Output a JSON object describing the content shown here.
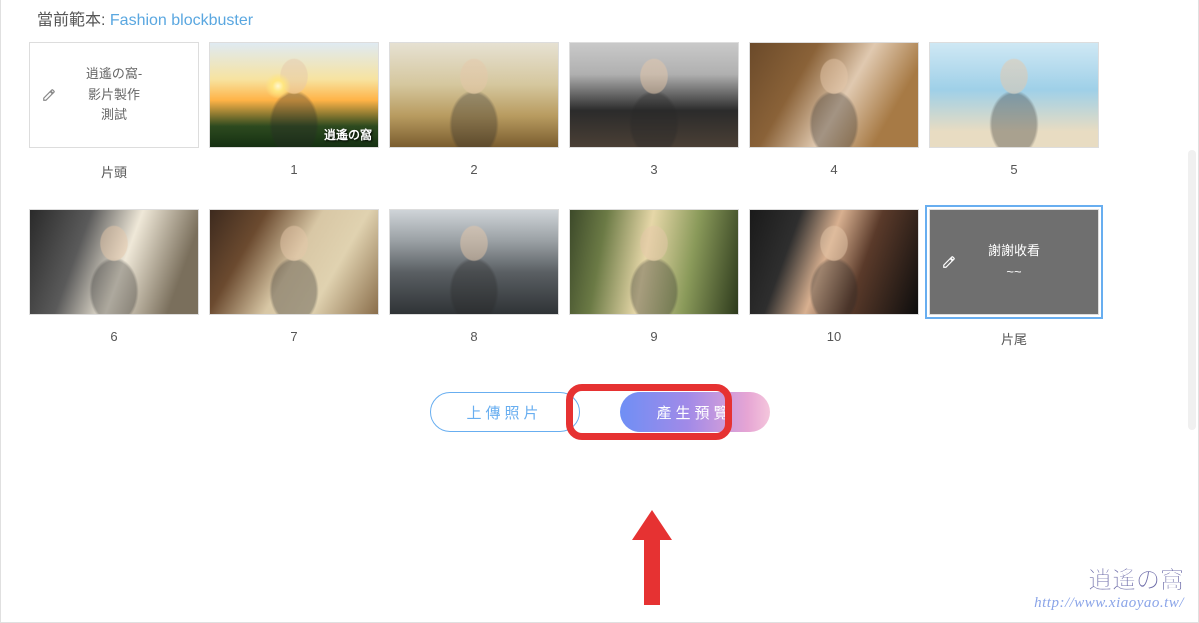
{
  "header": {
    "label": "當前範本: ",
    "template_name": "Fashion blockbuster"
  },
  "slots": [
    {
      "caption": "片頭",
      "kind": "text-card",
      "text": "逍遙の窩-\n影片製作\n測試",
      "white": true
    },
    {
      "caption": "1",
      "kind": "photo",
      "cls": "p1",
      "overlay_text": "逍遙の窩"
    },
    {
      "caption": "2",
      "kind": "photo",
      "cls": "p2"
    },
    {
      "caption": "3",
      "kind": "photo",
      "cls": "p3"
    },
    {
      "caption": "4",
      "kind": "photo",
      "cls": "p4"
    },
    {
      "caption": "5",
      "kind": "photo",
      "cls": "p5"
    },
    {
      "caption": "6",
      "kind": "photo",
      "cls": "p6"
    },
    {
      "caption": "7",
      "kind": "photo",
      "cls": "p7"
    },
    {
      "caption": "8",
      "kind": "photo",
      "cls": "p8"
    },
    {
      "caption": "9",
      "kind": "photo",
      "cls": "p9"
    },
    {
      "caption": "10",
      "kind": "photo",
      "cls": "p10"
    },
    {
      "caption": "片尾",
      "kind": "text-card",
      "text": "謝謝收看\n~~",
      "cls": "pend",
      "selected": true
    }
  ],
  "buttons": {
    "upload": "上傳照片",
    "preview": "產生預覽"
  },
  "watermark": {
    "line1": "逍遙の窩",
    "line2": "http://www.xiaoyao.tw/"
  }
}
